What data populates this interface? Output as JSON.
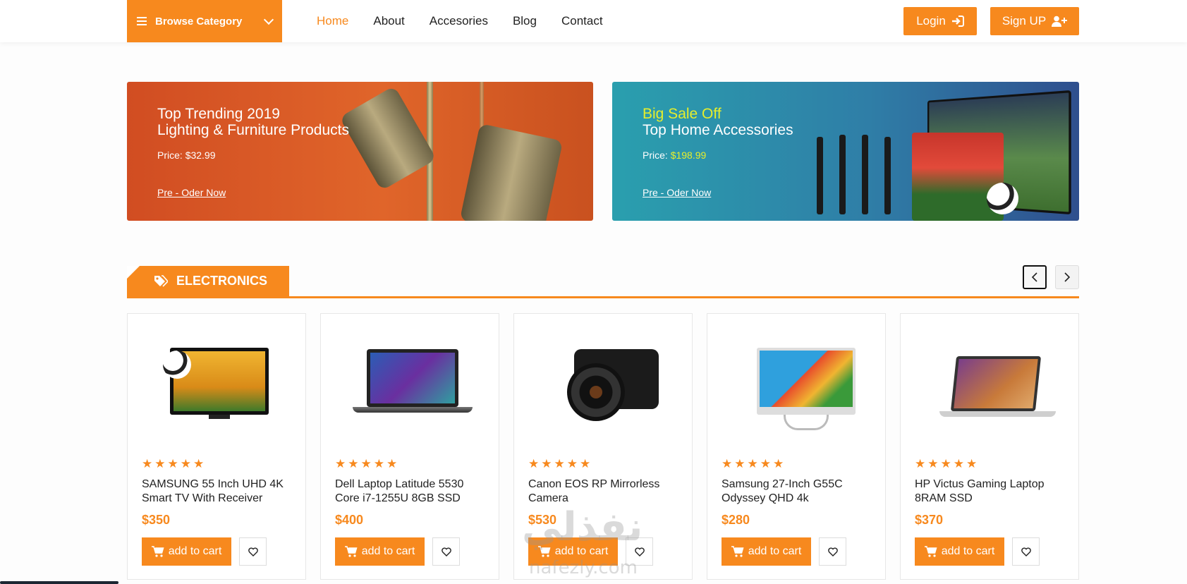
{
  "header": {
    "browse_label": "Browse Category",
    "nav": [
      "Home",
      "About",
      "Accesories",
      "Blog",
      "Contact"
    ],
    "login_label": "Login",
    "signup_label": "Sign UP"
  },
  "banners": [
    {
      "line1": "Top Trending 2019",
      "line2": "Lighting & Furniture Products",
      "price_label": "Price:",
      "price_value": "$32.99",
      "cta": "Pre - Oder Now"
    },
    {
      "line1": "Big Sale Off",
      "line2": "Top Home Accessories",
      "price_label": "Price:",
      "price_value": "$198.99",
      "cta": "Pre - Oder Now"
    }
  ],
  "section": {
    "title": "ELECTRONICS"
  },
  "products": [
    {
      "name": "SAMSUNG 55 Inch UHD 4K Smart TV With Receiver",
      "price": "$350",
      "rating": 5,
      "cart_label": "add to cart",
      "image": "tv-icon"
    },
    {
      "name": "Dell Laptop Latitude 5530 Core i7-1255U 8GB SSD",
      "price": "$400",
      "rating": 5,
      "cart_label": "add to cart",
      "image": "laptop-icon"
    },
    {
      "name": "Canon EOS RP Mirrorless Camera",
      "price": "$530",
      "rating": 5,
      "cart_label": "add to cart",
      "image": "camera-icon"
    },
    {
      "name": "Samsung 27-Inch G55C Odyssey QHD 4k",
      "price": "$280",
      "rating": 5,
      "cart_label": "add to cart",
      "image": "monitor-icon"
    },
    {
      "name": "HP Victus Gaming Laptop 8RAM SSD",
      "price": "$370",
      "rating": 5,
      "cart_label": "add to cart",
      "image": "laptop-icon"
    }
  ],
  "watermark": "نفذلي",
  "watermark_url": "nafezly.com",
  "colors": {
    "accent": "#f7891e",
    "banner1": "#d9592a",
    "banner2": "#2f7ea7",
    "banner2_highlight": "#e6ee2c"
  }
}
